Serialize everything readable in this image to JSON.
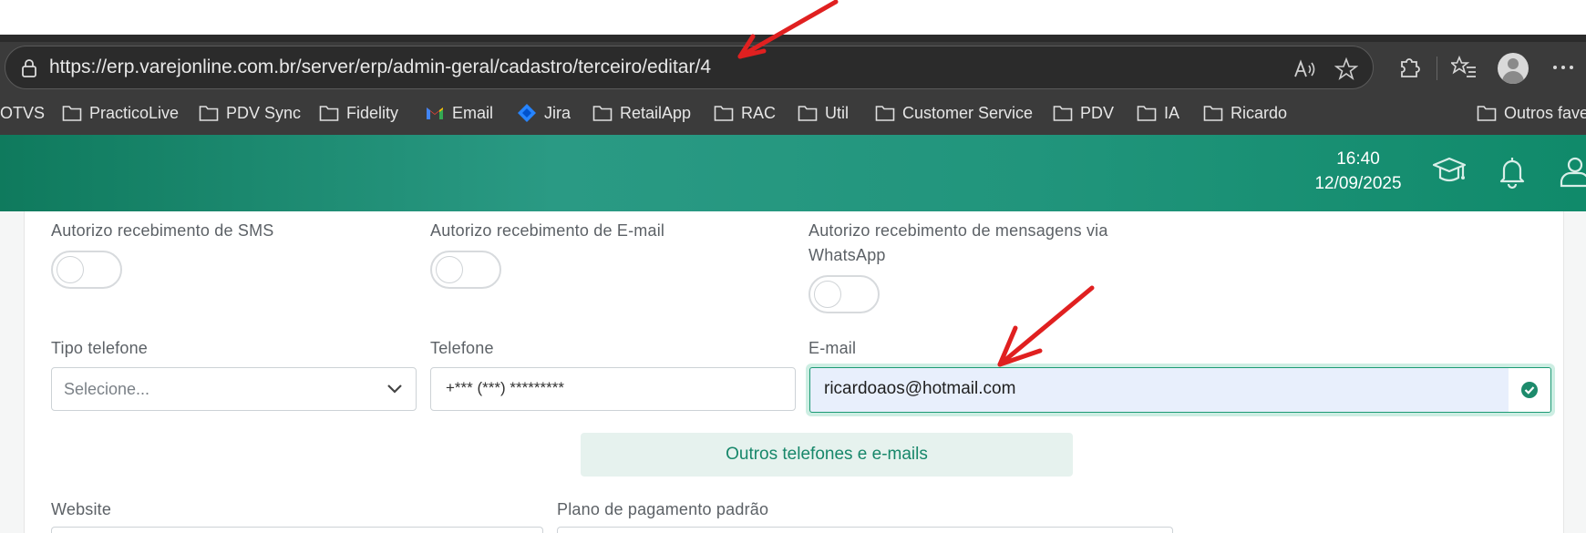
{
  "browser": {
    "url": "https://erp.varejonline.com.br/server/erp/admin-geral/cadastro/terceiro/editar/4",
    "icons": [
      "lock-icon",
      "read-aloud-icon",
      "favorite-star-icon",
      "extensions-icon",
      "favorites-list-icon",
      "profile-avatar",
      "more-icon"
    ]
  },
  "bookmarks": {
    "items": [
      {
        "label": "OTVS",
        "icon": "none"
      },
      {
        "label": "PracticoLive",
        "icon": "folder-icon"
      },
      {
        "label": "PDV Sync",
        "icon": "folder-icon"
      },
      {
        "label": "Fidelity",
        "icon": "folder-icon"
      },
      {
        "label": "Email",
        "icon": "gmail-icon"
      },
      {
        "label": "Jira",
        "icon": "jira-icon"
      },
      {
        "label": "RetailApp",
        "icon": "folder-icon"
      },
      {
        "label": "RAC",
        "icon": "folder-icon"
      },
      {
        "label": "Util",
        "icon": "folder-icon"
      },
      {
        "label": "Customer Service",
        "icon": "folder-icon"
      },
      {
        "label": "PDV",
        "icon": "folder-icon"
      },
      {
        "label": "IA",
        "icon": "folder-icon"
      },
      {
        "label": "Ricardo",
        "icon": "folder-icon"
      }
    ],
    "other": "Outros fave"
  },
  "header": {
    "time": "16:40",
    "date": "12/09/2025",
    "icons": [
      "graduation-cap-icon",
      "bell-icon",
      "user-icon"
    ],
    "colors": {
      "gradient_start": "#0f7a5d",
      "gradient_mid": "#2a9a84",
      "gradient_end": "#108a6a"
    }
  },
  "form": {
    "sms_label": "Autorizo recebimento de SMS",
    "email_consent_label": "Autorizo recebimento de E-mail",
    "whatsapp_label_line1": "Autorizo recebimento de mensagens via",
    "whatsapp_label_line2": "WhatsApp",
    "toggles": {
      "sms": false,
      "email": false,
      "whatsapp": false
    },
    "tipo_telefone_label": "Tipo telefone",
    "tipo_telefone_placeholder": "Selecione...",
    "telefone_label": "Telefone",
    "telefone_value": "+*** (***) *********",
    "email_label": "E-mail",
    "email_value": "ricardoaos@hotmail.com",
    "email_valid": true,
    "outros_button": "Outros telefones e e-mails",
    "website_label": "Website",
    "plano_label": "Plano de pagamento padrão",
    "accent_color": "#17876a"
  },
  "annotations": {
    "arrow_color": "#e02020",
    "arrows": [
      "arrow-to-url",
      "arrow-to-email"
    ]
  }
}
